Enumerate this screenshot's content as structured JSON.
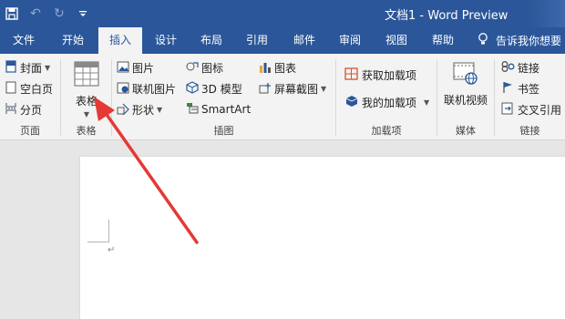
{
  "titlebar": {
    "doc_title": "文档1  -  Word Preview",
    "qat_icons": [
      "save-icon",
      "undo-icon",
      "redo-icon",
      "customize-qat-icon"
    ]
  },
  "tabs": [
    {
      "label": "文件"
    },
    {
      "label": "开始"
    },
    {
      "label": "插入",
      "active": true
    },
    {
      "label": "设计"
    },
    {
      "label": "布局"
    },
    {
      "label": "引用"
    },
    {
      "label": "邮件"
    },
    {
      "label": "审阅"
    },
    {
      "label": "视图"
    },
    {
      "label": "帮助"
    }
  ],
  "tell_me": "告诉我你想要",
  "ribbon": {
    "pages": {
      "label": "页面",
      "cover": "封面",
      "blank": "空白页",
      "break": "分页"
    },
    "table": {
      "label": "表格",
      "button": "表格"
    },
    "illustrations": {
      "label": "插图",
      "picture": "图片",
      "online_picture": "联机图片",
      "shapes": "形状",
      "icons": "图标",
      "model3d": "3D 模型",
      "smartart": "SmartArt",
      "chart": "图表",
      "screenshot": "屏幕截图"
    },
    "addins": {
      "label": "加载项",
      "get": "获取加载项",
      "my": "我的加载项"
    },
    "media": {
      "label": "媒体",
      "video": "联机视频"
    },
    "links": {
      "label": "链接",
      "link": "链接",
      "bookmark": "书签",
      "crossref": "交叉引用"
    }
  },
  "colors": {
    "accent": "#2b579a",
    "ribbon_bg": "#f3f3f3",
    "annotation": "#e53935"
  }
}
